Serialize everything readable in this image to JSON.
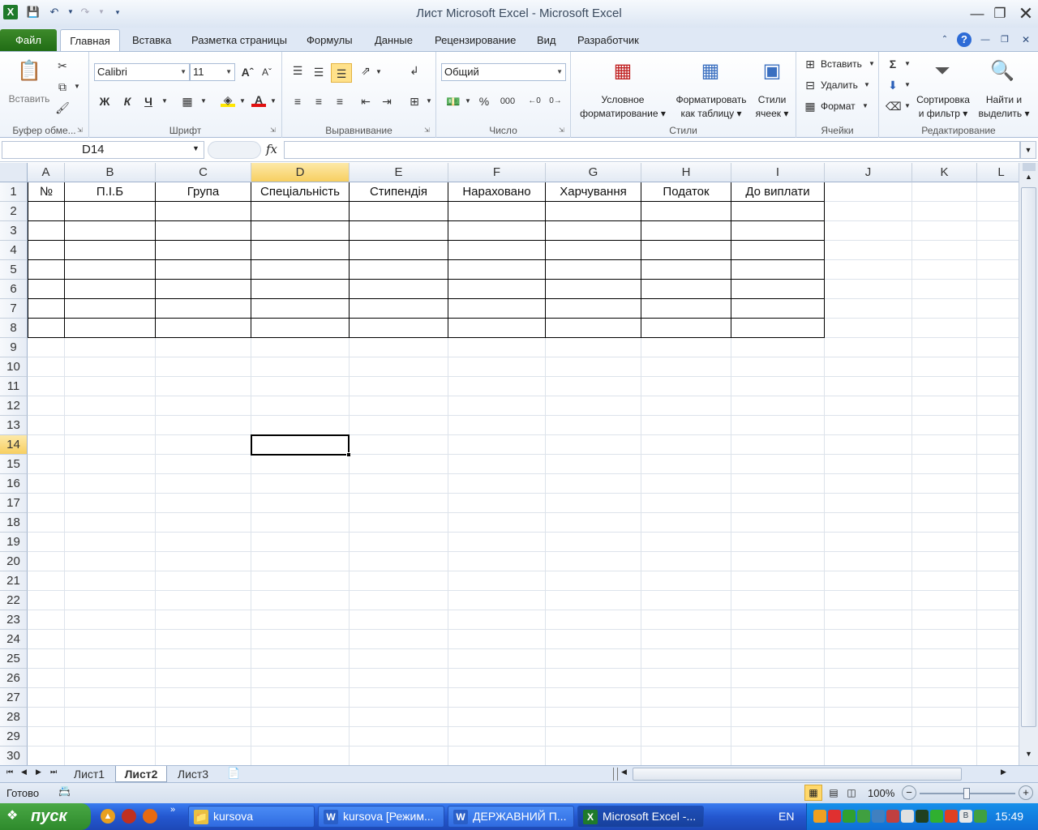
{
  "window": {
    "title": "Лист Microsoft Excel  -  Microsoft Excel"
  },
  "ribbon_tabs": [
    "Файл",
    "Главная",
    "Вставка",
    "Разметка страницы",
    "Формулы",
    "Данные",
    "Рецензирование",
    "Вид",
    "Разработчик"
  ],
  "ribbon": {
    "clipboard": {
      "label": "Буфер обме...",
      "paste": "Вставить"
    },
    "font": {
      "label": "Шрифт",
      "name": "Calibri",
      "size": "11",
      "bold": "Ж",
      "italic": "К",
      "underline": "Ч"
    },
    "alignment": {
      "label": "Выравнивание"
    },
    "number": {
      "label": "Число",
      "format": "Общий",
      "percent": "%",
      "thousands": "000"
    },
    "styles": {
      "label": "Стили",
      "conditional_1": "Условное",
      "conditional_2": "форматирование",
      "table_1": "Форматировать",
      "table_2": "как таблицу",
      "cell_1": "Стили",
      "cell_2": "ячеек"
    },
    "cells": {
      "label": "Ячейки",
      "insert": "Вставить",
      "delete": "Удалить",
      "format": "Формат"
    },
    "editing": {
      "label": "Редактирование",
      "sigma": "Σ",
      "sort_1": "Сортировка",
      "sort_2": "и фильтр",
      "find_1": "Найти и",
      "find_2": "выделить"
    }
  },
  "formula_bar": {
    "name_box": "D14",
    "fx": "fx",
    "value": ""
  },
  "sheet": {
    "columns": [
      "A",
      "B",
      "C",
      "D",
      "E",
      "F",
      "G",
      "H",
      "I",
      "J",
      "K",
      "L"
    ],
    "rows": [
      "1",
      "2",
      "3",
      "4",
      "5",
      "6",
      "7",
      "8",
      "9",
      "10",
      "11",
      "12",
      "13",
      "14",
      "15",
      "16",
      "17",
      "18",
      "19",
      "20",
      "21",
      "22",
      "23",
      "24",
      "25",
      "26",
      "27",
      "28",
      "29",
      "30"
    ],
    "header_cells": [
      "№",
      "П.І.Б",
      "Група",
      "Спеціальність",
      "Стипендія",
      "Нараховано",
      "Харчування",
      "Податок",
      "До виплати"
    ],
    "active_cell": "D14"
  },
  "sheet_tabs": [
    "Лист1",
    "Лист2",
    "Лист3"
  ],
  "active_sheet": "Лист2",
  "status": {
    "ready": "Готово",
    "zoom": "100%"
  },
  "taskbar": {
    "start": "пуск",
    "items": [
      "kursova",
      "kursova [Режим...",
      "ДЕРЖАВНИЙ П...",
      "Microsoft Excel -..."
    ],
    "lang": "EN",
    "clock": "15:49"
  },
  "colors": {
    "excel_green": "#1f6b14",
    "selection_header": "#f7cf61",
    "taskbar_blue": "#2457cf"
  }
}
